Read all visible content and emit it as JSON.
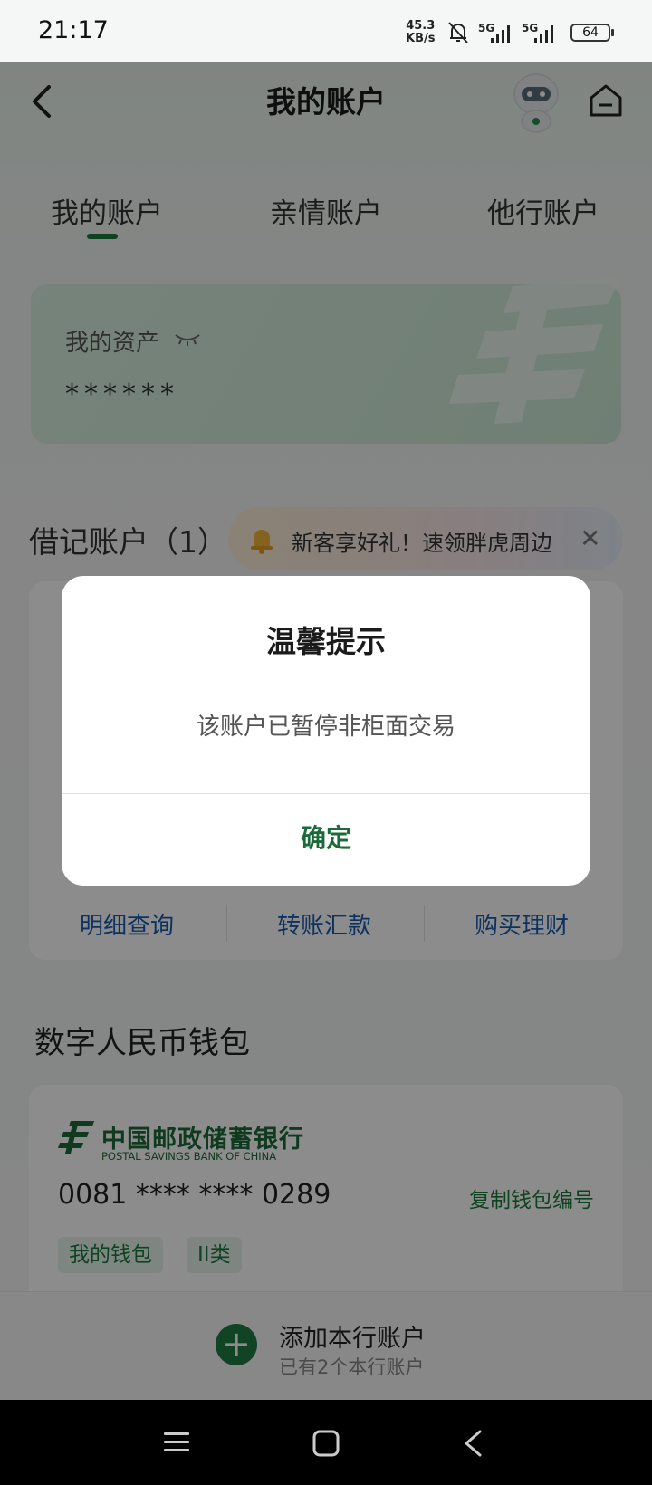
{
  "status_bar": {
    "time": "21:17",
    "net_speed_value": "45.3",
    "net_speed_unit": "KB/s",
    "signal_1": "5G",
    "signal_2": "5G",
    "battery": "64"
  },
  "header": {
    "title": "我的账户"
  },
  "tabs": [
    {
      "label": "我的账户",
      "active": true
    },
    {
      "label": "亲情账户",
      "active": false
    },
    {
      "label": "他行账户",
      "active": false
    }
  ],
  "assets": {
    "label": "我的资产",
    "value": "******"
  },
  "debit": {
    "title": "借记账户（1）",
    "promo": "新客享好礼！速领胖虎周边",
    "actions": [
      "明细查询",
      "转账汇款",
      "购买理财"
    ]
  },
  "wallet": {
    "title": "数字人民币钱包",
    "bank_name_cn": "中国邮政储蓄银行",
    "bank_name_en": "POSTAL SAVINGS BANK OF CHINA",
    "number": "0081 **** **** 0289",
    "copy_label": "复制钱包编号",
    "tags": [
      "我的钱包",
      "II类"
    ]
  },
  "bottom": {
    "add_title": "添加本行账户",
    "add_sub": "已有2个本行账户"
  },
  "dialog": {
    "title": "温馨提示",
    "message": "该账户已暂停非柜面交易",
    "confirm": "确定"
  },
  "colors": {
    "brand_green": "#1a7a3c",
    "link_blue": "#1a5bb0",
    "overlay": "rgba(0,0,0,0.45)"
  }
}
